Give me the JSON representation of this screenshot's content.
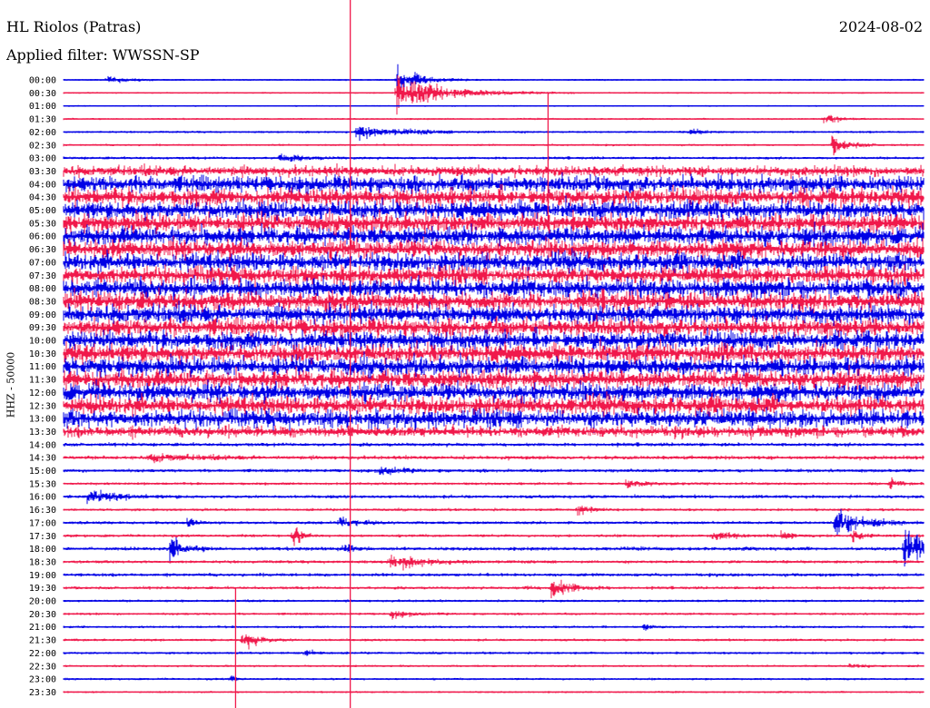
{
  "header": {
    "station": "HL Riolos (Patras)",
    "date": "2024-08-02",
    "filter": "Applied filter: WWSSN-SP"
  },
  "colors": {
    "primary": "#0000e6",
    "secondary": "#f0194b",
    "background": "#ffffff"
  },
  "chart_data": {
    "type": "helicorder",
    "ylabel": "HHZ - 50000",
    "row_labels": [
      "00:00",
      "00:30",
      "01:00",
      "01:30",
      "02:00",
      "02:30",
      "03:00",
      "03:30",
      "04:00",
      "04:30",
      "05:00",
      "05:30",
      "06:00",
      "06:30",
      "07:00",
      "07:30",
      "08:00",
      "08:30",
      "09:00",
      "09:30",
      "10:00",
      "10:30",
      "11:00",
      "11:30",
      "12:00",
      "12:30",
      "13:00",
      "13:30",
      "14:00",
      "14:30",
      "15:00",
      "15:30",
      "16:00",
      "16:30",
      "17:00",
      "17:30",
      "18:00",
      "18:30",
      "19:00",
      "19:30",
      "20:00",
      "20:30",
      "21:00",
      "21:30",
      "22:00",
      "22:30",
      "23:00",
      "23:30"
    ],
    "row_minutes": 30,
    "trace_colors_alternate": [
      "#0000e6",
      "#f0194b"
    ],
    "noise_amplitude": [
      0.06,
      0.06,
      0.05,
      0.07,
      0.1,
      0.09,
      0.14,
      0.7,
      1.2,
      1.25,
      1.3,
      1.35,
      1.3,
      1.35,
      1.3,
      1.3,
      1.35,
      1.35,
      1.3,
      1.3,
      1.3,
      1.35,
      1.35,
      1.3,
      1.3,
      1.3,
      1.3,
      0.75,
      0.2,
      0.22,
      0.18,
      0.14,
      0.18,
      0.14,
      0.16,
      0.15,
      0.2,
      0.17,
      0.18,
      0.15,
      0.12,
      0.12,
      0.12,
      0.12,
      0.12,
      0.1,
      0.1,
      0.08
    ],
    "events": [
      {
        "row": 0,
        "minute": 1.5,
        "amplitude": 0.6,
        "duration": 1
      },
      {
        "row": 0,
        "minute": 11.6,
        "amplitude": 2.4,
        "duration": 1.2
      },
      {
        "row": 1,
        "minute": 11.6,
        "amplitude": 3.0,
        "duration": 2.5
      },
      {
        "row": 4,
        "minute": 10.2,
        "amplitude": 1.0,
        "duration": 2.5
      },
      {
        "row": 4,
        "minute": 21.8,
        "amplitude": 0.7,
        "duration": 0.6
      },
      {
        "row": 3,
        "minute": 26.5,
        "amplitude": 1.2,
        "duration": 0.6
      },
      {
        "row": 5,
        "minute": 26.8,
        "amplitude": 1.5,
        "duration": 0.9
      },
      {
        "row": 6,
        "minute": 7.5,
        "amplitude": 0.6,
        "duration": 1.3
      },
      {
        "row": 29,
        "minute": 3.0,
        "amplitude": 0.6,
        "duration": 2.5
      },
      {
        "row": 30,
        "minute": 11.0,
        "amplitude": 0.7,
        "duration": 1.2
      },
      {
        "row": 31,
        "minute": 19.6,
        "amplitude": 0.6,
        "duration": 1.2
      },
      {
        "row": 31,
        "minute": 28.8,
        "amplitude": 1.0,
        "duration": 0.4
      },
      {
        "row": 32,
        "minute": 0.8,
        "amplitude": 1.1,
        "duration": 1.5
      },
      {
        "row": 33,
        "minute": 17.9,
        "amplitude": 1.6,
        "duration": 0.5
      },
      {
        "row": 34,
        "minute": 4.3,
        "amplitude": 0.8,
        "duration": 0.4
      },
      {
        "row": 34,
        "minute": 9.6,
        "amplitude": 0.9,
        "duration": 1
      },
      {
        "row": 34,
        "minute": 26.9,
        "amplitude": 3.0,
        "duration": 1.2
      },
      {
        "row": 35,
        "minute": 8.0,
        "amplitude": 2.0,
        "duration": 0.4
      },
      {
        "row": 35,
        "minute": 22.6,
        "amplitude": 0.8,
        "duration": 1.2
      },
      {
        "row": 35,
        "minute": 25.0,
        "amplitude": 1.2,
        "duration": 0.4
      },
      {
        "row": 35,
        "minute": 27.5,
        "amplitude": 1.3,
        "duration": 0.5
      },
      {
        "row": 36,
        "minute": 3.7,
        "amplitude": 2.0,
        "duration": 0.8
      },
      {
        "row": 36,
        "minute": 9.7,
        "amplitude": 1.2,
        "duration": 0.5
      },
      {
        "row": 36,
        "minute": 29.3,
        "amplitude": 3.8,
        "duration": 1.5
      },
      {
        "row": 37,
        "minute": 11.3,
        "amplitude": 1.4,
        "duration": 1.6
      },
      {
        "row": 39,
        "minute": 17.0,
        "amplitude": 1.7,
        "duration": 1.1
      },
      {
        "row": 39,
        "minute": 16.0,
        "amplitude": 0.4,
        "duration": 0.4
      },
      {
        "row": 41,
        "minute": 11.4,
        "amplitude": 0.6,
        "duration": 1
      },
      {
        "row": 42,
        "minute": 20.2,
        "amplitude": 1.0,
        "duration": 0.3
      },
      {
        "row": 43,
        "minute": 6.2,
        "amplitude": 1.8,
        "duration": 0.8
      },
      {
        "row": 44,
        "minute": 8.4,
        "amplitude": 0.7,
        "duration": 0.6
      },
      {
        "row": 45,
        "minute": 27.4,
        "amplitude": 0.5,
        "duration": 0.6
      },
      {
        "row": 46,
        "minute": 5.8,
        "amplitude": 0.8,
        "duration": 0.3
      }
    ],
    "vertical_spikes": [
      {
        "minute_row": 0,
        "minute": 10.0,
        "to_row": 47
      },
      {
        "minute_row": 1,
        "minute": 16.9,
        "to_row": 11
      },
      {
        "minute_row": 39,
        "minute": 6.0,
        "to_row": 47
      }
    ]
  }
}
